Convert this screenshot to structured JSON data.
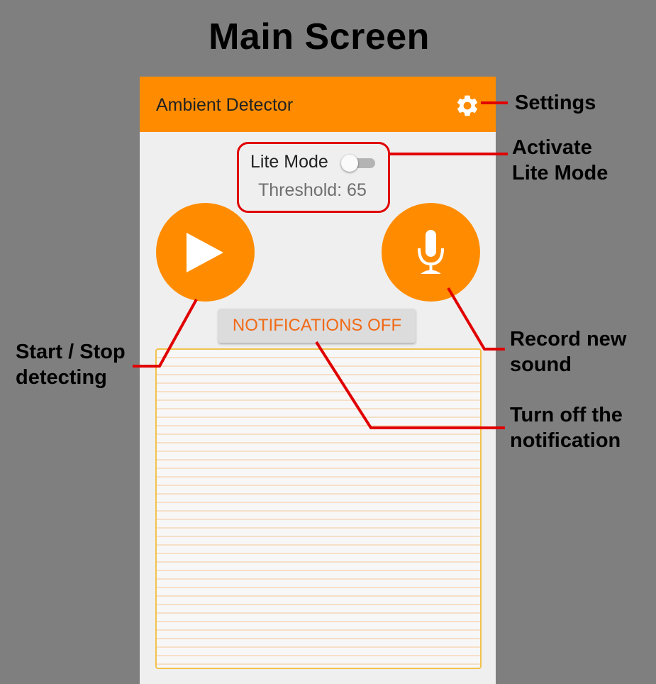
{
  "title": "Main Screen",
  "app": {
    "title": "Ambient Detector",
    "settings_icon": "gear-icon",
    "lite_mode": {
      "label": "Lite Mode",
      "enabled": false
    },
    "threshold": "Threshold: 65",
    "start_button_icon": "play-icon",
    "record_button_icon": "microphone-icon",
    "notifications_button": "NOTIFICATIONS OFF"
  },
  "annotations": {
    "settings": "Settings",
    "lite_mode_1": "Activate",
    "lite_mode_2": "Lite Mode",
    "start_stop_1": "Start / Stop",
    "start_stop_2": "detecting",
    "record_1": "Record new",
    "record_2": "sound",
    "notification_1": "Turn off the",
    "notification_2": "notification"
  },
  "colors": {
    "accent": "#ff8c00",
    "annotation_line": "#e00000",
    "notification_text": "#f06a16",
    "background": "#7f7f7f"
  }
}
